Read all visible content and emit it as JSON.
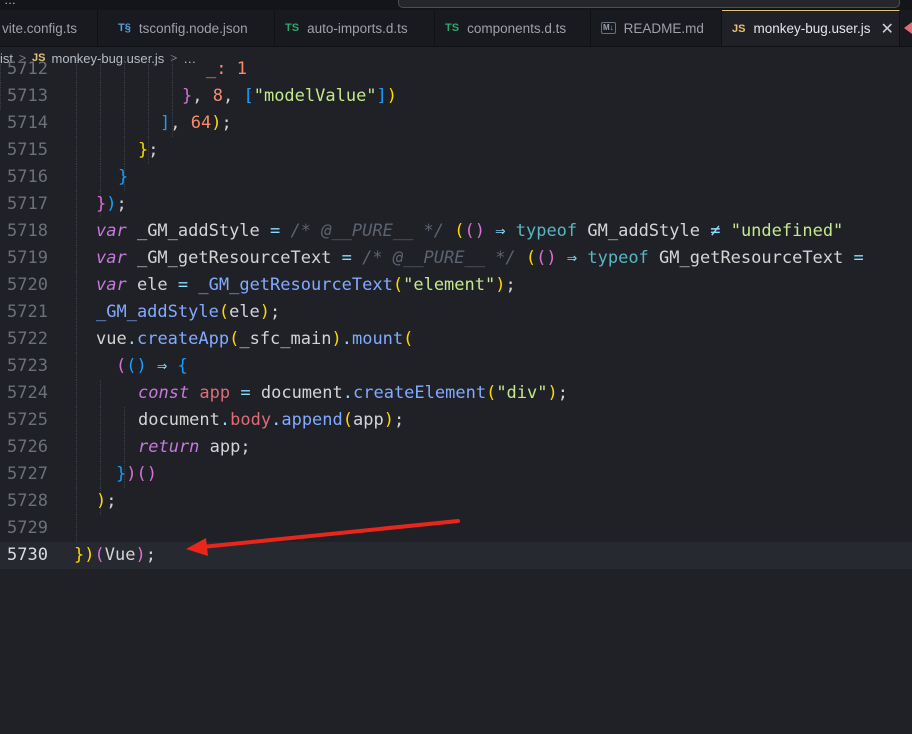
{
  "top_fragment": "…",
  "tabs": [
    {
      "label": "vite.config.ts",
      "icon": "ts-file-icon",
      "active": false
    },
    {
      "label": "tsconfig.node.json",
      "icon": "ts-config-icon",
      "active": false
    },
    {
      "label": "auto-imports.d.ts",
      "icon": "ts-file-icon",
      "active": false
    },
    {
      "label": "components.d.ts",
      "icon": "ts-file-icon",
      "active": false
    },
    {
      "label": "README.md",
      "icon": "markdown-file-icon",
      "active": false
    },
    {
      "label": "monkey-bug.user.js",
      "icon": "js-file-icon",
      "active": true
    }
  ],
  "tab_icon_text": {
    "ts": "TS",
    "js": "JS",
    "md": "M↓",
    "tsconfig": "T§"
  },
  "breadcrumb": {
    "folder": "ist",
    "file_icon": "JS",
    "file": "monkey-bug.user.js",
    "more": "…"
  },
  "editor": {
    "current_line": "5730",
    "lines": [
      {
        "n": "5712",
        "partial": true,
        "tokens": [
          {
            "t": "_: 1",
            "c": "n"
          }
        ]
      },
      {
        "n": "5713",
        "tokens": [
          {
            "t": "}",
            "c": "b2"
          },
          {
            "t": ", ",
            "c": "plain"
          },
          {
            "t": "8",
            "c": "n"
          },
          {
            "t": ", ",
            "c": "plain"
          },
          {
            "t": "[",
            "c": "b3"
          },
          {
            "t": "\"modelValue\"",
            "c": "s"
          },
          {
            "t": "]",
            "c": "b3"
          },
          {
            "t": ")",
            "c": "b1"
          }
        ]
      },
      {
        "n": "5714",
        "tokens": [
          {
            "t": "]",
            "c": "b3"
          },
          {
            "t": ", ",
            "c": "plain"
          },
          {
            "t": "64",
            "c": "n"
          },
          {
            "t": ")",
            "c": "b1"
          },
          {
            "t": ";",
            "c": "plain"
          }
        ]
      },
      {
        "n": "5715",
        "tokens": [
          {
            "t": "}",
            "c": "b1"
          },
          {
            "t": ";",
            "c": "plain"
          }
        ]
      },
      {
        "n": "5716",
        "tokens": [
          {
            "t": "}",
            "c": "b3"
          }
        ]
      },
      {
        "n": "5717",
        "tokens": [
          {
            "t": "}",
            "c": "b2"
          },
          {
            "t": ")",
            "c": "b3"
          },
          {
            "t": ";",
            "c": "plain"
          }
        ]
      },
      {
        "n": "5718",
        "tokens": [
          {
            "t": "var",
            "c": "k"
          },
          {
            "t": " _GM_addStyle ",
            "c": "plain"
          },
          {
            "t": "=",
            "c": "op"
          },
          {
            "t": " /* @__PURE__ */ ",
            "c": "c"
          },
          {
            "t": "(",
            "c": "b1"
          },
          {
            "t": "(",
            "c": "b2"
          },
          {
            "t": ")",
            "c": "b2"
          },
          {
            "t": " ⇒ ",
            "c": "op"
          },
          {
            "t": "typeof",
            "c": "tk"
          },
          {
            "t": " GM_addStyle ",
            "c": "plain"
          },
          {
            "t": "≠",
            "c": "op"
          },
          {
            "t": " \"undefined\"",
            "c": "s"
          }
        ]
      },
      {
        "n": "5719",
        "tokens": [
          {
            "t": "var",
            "c": "k"
          },
          {
            "t": " _GM_getResourceText ",
            "c": "plain"
          },
          {
            "t": "=",
            "c": "op"
          },
          {
            "t": " /* @__PURE__ */ ",
            "c": "c"
          },
          {
            "t": "(",
            "c": "b1"
          },
          {
            "t": "(",
            "c": "b2"
          },
          {
            "t": ")",
            "c": "b2"
          },
          {
            "t": " ⇒ ",
            "c": "op"
          },
          {
            "t": "typeof",
            "c": "tk"
          },
          {
            "t": " GM_getResourceText ",
            "c": "plain"
          },
          {
            "t": "=",
            "c": "op"
          }
        ]
      },
      {
        "n": "5720",
        "tokens": [
          {
            "t": "var",
            "c": "k"
          },
          {
            "t": " ele ",
            "c": "plain"
          },
          {
            "t": "=",
            "c": "op"
          },
          {
            "t": " _GM_getResourceText",
            "c": "f"
          },
          {
            "t": "(",
            "c": "b1"
          },
          {
            "t": "\"element\"",
            "c": "s"
          },
          {
            "t": ")",
            "c": "b1"
          },
          {
            "t": ";",
            "c": "plain"
          }
        ]
      },
      {
        "n": "5721",
        "tokens": [
          {
            "t": "_GM_addStyle",
            "c": "f"
          },
          {
            "t": "(",
            "c": "b1"
          },
          {
            "t": "ele",
            "c": "plain"
          },
          {
            "t": ")",
            "c": "b1"
          },
          {
            "t": ";",
            "c": "plain"
          }
        ]
      },
      {
        "n": "5722",
        "tokens": [
          {
            "t": "vue",
            "c": "plain"
          },
          {
            "t": ".",
            "c": "op"
          },
          {
            "t": "createApp",
            "c": "f"
          },
          {
            "t": "(",
            "c": "b1"
          },
          {
            "t": "_sfc_main",
            "c": "plain"
          },
          {
            "t": ")",
            "c": "b1"
          },
          {
            "t": ".",
            "c": "op"
          },
          {
            "t": "mount",
            "c": "f"
          },
          {
            "t": "(",
            "c": "b1"
          }
        ]
      },
      {
        "n": "5723",
        "tokens": [
          {
            "t": "(",
            "c": "b2"
          },
          {
            "t": "(",
            "c": "b3"
          },
          {
            "t": ")",
            "c": "b3"
          },
          {
            "t": " ⇒ ",
            "c": "op"
          },
          {
            "t": "{",
            "c": "b3"
          }
        ]
      },
      {
        "n": "5724",
        "tokens": [
          {
            "t": "const",
            "c": "k"
          },
          {
            "t": " app ",
            "c": "v"
          },
          {
            "t": "=",
            "c": "op"
          },
          {
            "t": " document",
            "c": "plain"
          },
          {
            "t": ".",
            "c": "op"
          },
          {
            "t": "createElement",
            "c": "f"
          },
          {
            "t": "(",
            "c": "b1"
          },
          {
            "t": "\"div\"",
            "c": "s"
          },
          {
            "t": ")",
            "c": "b1"
          },
          {
            "t": ";",
            "c": "plain"
          }
        ]
      },
      {
        "n": "5725",
        "tokens": [
          {
            "t": "document",
            "c": "plain"
          },
          {
            "t": ".",
            "c": "op"
          },
          {
            "t": "body",
            "c": "v"
          },
          {
            "t": ".",
            "c": "op"
          },
          {
            "t": "append",
            "c": "f"
          },
          {
            "t": "(",
            "c": "b1"
          },
          {
            "t": "app",
            "c": "plain"
          },
          {
            "t": ")",
            "c": "b1"
          },
          {
            "t": ";",
            "c": "plain"
          }
        ]
      },
      {
        "n": "5726",
        "tokens": [
          {
            "t": "return",
            "c": "k"
          },
          {
            "t": " app;",
            "c": "plain"
          }
        ]
      },
      {
        "n": "5727",
        "tokens": [
          {
            "t": "}",
            "c": "b3"
          },
          {
            "t": ")",
            "c": "b2"
          },
          {
            "t": "(",
            "c": "b2"
          },
          {
            "t": ")",
            "c": "b2"
          }
        ]
      },
      {
        "n": "5728",
        "tokens": [
          {
            "t": ")",
            "c": "b1"
          },
          {
            "t": ";",
            "c": "plain"
          }
        ]
      },
      {
        "n": "5729",
        "tokens": []
      },
      {
        "n": "5730",
        "tokens": [
          {
            "t": "}",
            "c": "b1"
          },
          {
            "t": ")",
            "c": "b1"
          },
          {
            "t": "(",
            "c": "b2"
          },
          {
            "t": "Vue",
            "c": "plain"
          },
          {
            "t": ")",
            "c": "b2"
          },
          {
            "t": ";",
            "c": "plain"
          }
        ]
      }
    ]
  },
  "annotation": {
    "type": "red-arrow",
    "color": "#e8261c"
  }
}
